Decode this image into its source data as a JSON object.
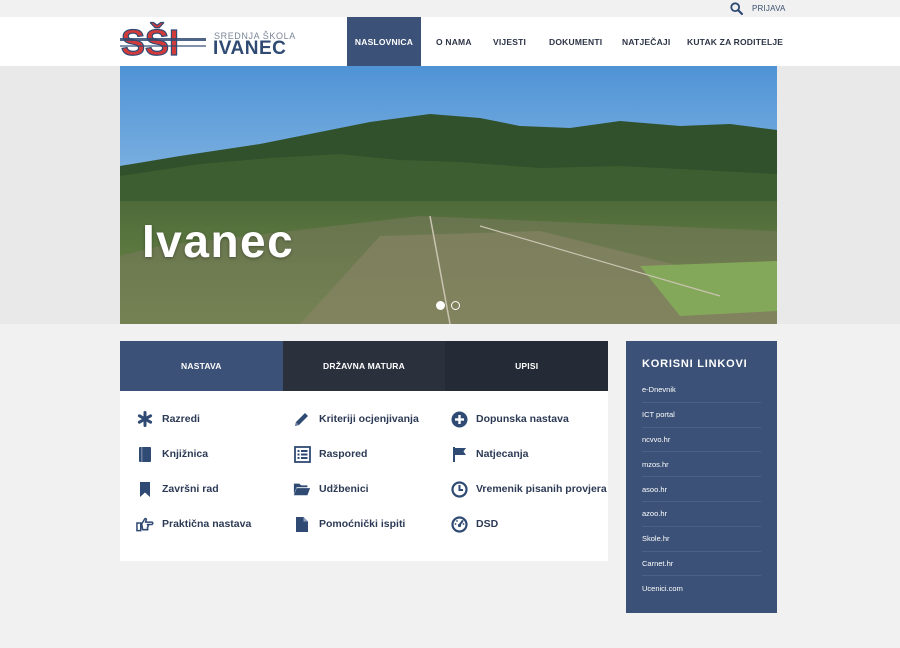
{
  "utility": {
    "login_label": "PRIJAVA",
    "search_icon": "search-icon"
  },
  "logo": {
    "mark_text": "SŠI",
    "subtitle": "SREDNJA ŠKOLA",
    "name": "IVANEC"
  },
  "nav": {
    "items": [
      {
        "label": "NASLOVNICA",
        "active": true
      },
      {
        "label": "O NAMA"
      },
      {
        "label": "VIJESTI"
      },
      {
        "label": "DOKUMENTI"
      },
      {
        "label": "NATJEČAJI"
      },
      {
        "label": "KUTAK ZA RODITELJE"
      }
    ]
  },
  "hero": {
    "caption": "Ivanec",
    "slides": 2,
    "active_slide": 1
  },
  "panel": {
    "tabs": [
      {
        "label": "NASTAVA"
      },
      {
        "label": "DRŽAVNA MATURA"
      },
      {
        "label": "UPISI"
      }
    ],
    "links": [
      {
        "label": "Razredi",
        "icon": "asterisk-icon"
      },
      {
        "label": "Kriteriji ocjenjivanja",
        "icon": "pencil-icon"
      },
      {
        "label": "Dopunska nastava",
        "icon": "plus-circle-icon"
      },
      {
        "label": "Knjižnica",
        "icon": "book-icon"
      },
      {
        "label": "Raspored",
        "icon": "list-icon"
      },
      {
        "label": "Natjecanja",
        "icon": "flag-icon"
      },
      {
        "label": "Završni rad",
        "icon": "bookmark-icon"
      },
      {
        "label": "Udžbenici",
        "icon": "folder-open-icon"
      },
      {
        "label": "Vremenik pisanih provjera",
        "icon": "clock-icon"
      },
      {
        "label": "Praktična nastava",
        "icon": "hand-pointer-icon"
      },
      {
        "label": "Pomoćnički ispiti",
        "icon": "file-icon"
      },
      {
        "label": "DSD",
        "icon": "dashboard-icon"
      }
    ]
  },
  "sidebar": {
    "title": "KORISNI LINKOVI",
    "items": [
      {
        "label": "e-Dnevnik"
      },
      {
        "label": "ICT portal"
      },
      {
        "label": "ncvvo.hr"
      },
      {
        "label": "mzos.hr"
      },
      {
        "label": "asoo.hr"
      },
      {
        "label": "azoo.hr"
      },
      {
        "label": "Skole.hr"
      },
      {
        "label": "Carnet.hr"
      },
      {
        "label": "Ucenici.com"
      }
    ]
  },
  "colors": {
    "brand": "#3b5177",
    "dark_tab": "#2a303c",
    "text": "#2c3a55",
    "accent_red": "#d33a3a"
  }
}
